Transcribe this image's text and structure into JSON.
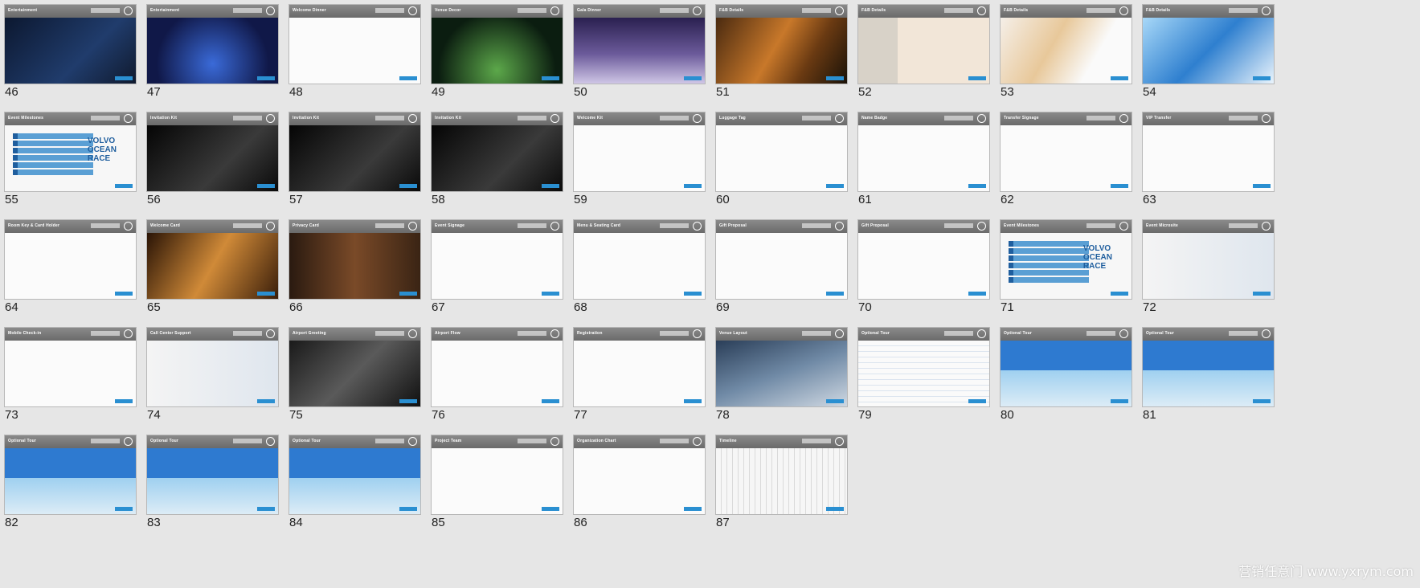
{
  "slides": [
    {
      "n": "46",
      "bar": "Entertainment",
      "v": "v-dark"
    },
    {
      "n": "47",
      "bar": "Entertainment",
      "v": "v-stage"
    },
    {
      "n": "48",
      "bar": "Welcome Dinner",
      "v": "v-white"
    },
    {
      "n": "49",
      "bar": "Venue Decor",
      "v": "v-night"
    },
    {
      "n": "50",
      "bar": "Gala Dinner",
      "v": "v-purple"
    },
    {
      "n": "51",
      "bar": "F&B Details",
      "v": "v-food"
    },
    {
      "n": "52",
      "bar": "F&B Details",
      "v": "v-food2"
    },
    {
      "n": "53",
      "bar": "F&B Details",
      "v": "v-dessert"
    },
    {
      "n": "54",
      "bar": "F&B Details",
      "v": "v-blue"
    },
    {
      "n": "55",
      "bar": "Event Milestones",
      "v": "v-ocean",
      "ocean": true
    },
    {
      "n": "56",
      "bar": "Invitation Kit",
      "v": "v-black"
    },
    {
      "n": "57",
      "bar": "Invitation Kit",
      "v": "v-black"
    },
    {
      "n": "58",
      "bar": "Invitation Kit",
      "v": "v-black"
    },
    {
      "n": "59",
      "bar": "Welcome Kit",
      "v": "v-white"
    },
    {
      "n": "60",
      "bar": "Luggage Tag",
      "v": "v-white"
    },
    {
      "n": "61",
      "bar": "Name Badge",
      "v": "v-white"
    },
    {
      "n": "62",
      "bar": "Transfer Signage",
      "v": "v-white"
    },
    {
      "n": "63",
      "bar": "VIP Transfer",
      "v": "v-white"
    },
    {
      "n": "64",
      "bar": "Room Key & Card Holder",
      "v": "v-white"
    },
    {
      "n": "65",
      "bar": "Welcome Card",
      "v": "v-warm"
    },
    {
      "n": "66",
      "bar": "Privacy Card",
      "v": "v-door"
    },
    {
      "n": "67",
      "bar": "Event Signage",
      "v": "v-white"
    },
    {
      "n": "68",
      "bar": "Menu & Seating Card",
      "v": "v-white"
    },
    {
      "n": "69",
      "bar": "Gift Proposal",
      "v": "v-white"
    },
    {
      "n": "70",
      "bar": "Gift Proposal",
      "v": "v-white"
    },
    {
      "n": "71",
      "bar": "Event Milestones",
      "v": "v-ocean",
      "ocean": true
    },
    {
      "n": "72",
      "bar": "Event Microsite",
      "v": "v-office"
    },
    {
      "n": "73",
      "bar": "Mobile Check-in",
      "v": "v-white"
    },
    {
      "n": "74",
      "bar": "Call Center Support",
      "v": "v-office"
    },
    {
      "n": "75",
      "bar": "Airport Greeting",
      "v": "v-meet"
    },
    {
      "n": "76",
      "bar": "Airport Flow",
      "v": "v-white"
    },
    {
      "n": "77",
      "bar": "Registration",
      "v": "v-white"
    },
    {
      "n": "78",
      "bar": "Venue Layout",
      "v": "v-map"
    },
    {
      "n": "79",
      "bar": "Optional Tour",
      "v": "v-table"
    },
    {
      "n": "80",
      "bar": "Optional Tour",
      "v": "v-sea"
    },
    {
      "n": "81",
      "bar": "Optional Tour",
      "v": "v-sea"
    },
    {
      "n": "82",
      "bar": "Optional Tour",
      "v": "v-sea"
    },
    {
      "n": "83",
      "bar": "Optional Tour",
      "v": "v-sea"
    },
    {
      "n": "84",
      "bar": "Optional Tour",
      "v": "v-sea"
    },
    {
      "n": "85",
      "bar": "Project Team",
      "v": "v-white"
    },
    {
      "n": "86",
      "bar": "Organization Chart",
      "v": "v-white"
    },
    {
      "n": "87",
      "bar": "Timeline",
      "v": "v-gantt"
    }
  ],
  "ocean_words": [
    "VOLVO",
    "OCEAN",
    "RACE"
  ],
  "watermark": "营销任意门 www.yxrym.com"
}
